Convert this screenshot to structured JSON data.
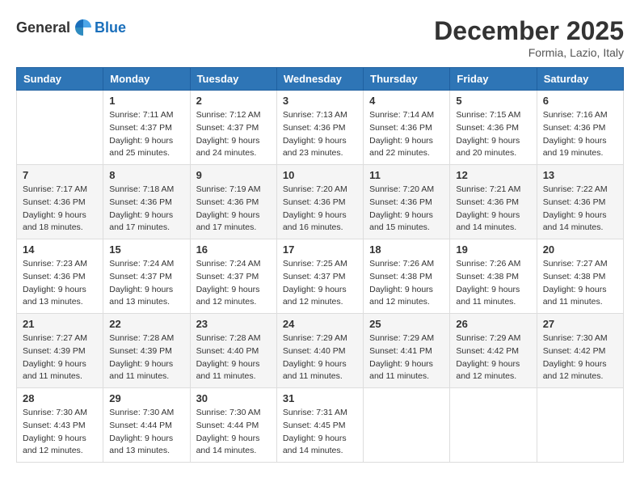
{
  "header": {
    "logo_general": "General",
    "logo_blue": "Blue",
    "month_title": "December 2025",
    "location": "Formia, Lazio, Italy"
  },
  "days_of_week": [
    "Sunday",
    "Monday",
    "Tuesday",
    "Wednesday",
    "Thursday",
    "Friday",
    "Saturday"
  ],
  "weeks": [
    [
      {
        "day": "",
        "info": ""
      },
      {
        "day": "1",
        "info": "Sunrise: 7:11 AM\nSunset: 4:37 PM\nDaylight: 9 hours\nand 25 minutes."
      },
      {
        "day": "2",
        "info": "Sunrise: 7:12 AM\nSunset: 4:37 PM\nDaylight: 9 hours\nand 24 minutes."
      },
      {
        "day": "3",
        "info": "Sunrise: 7:13 AM\nSunset: 4:36 PM\nDaylight: 9 hours\nand 23 minutes."
      },
      {
        "day": "4",
        "info": "Sunrise: 7:14 AM\nSunset: 4:36 PM\nDaylight: 9 hours\nand 22 minutes."
      },
      {
        "day": "5",
        "info": "Sunrise: 7:15 AM\nSunset: 4:36 PM\nDaylight: 9 hours\nand 20 minutes."
      },
      {
        "day": "6",
        "info": "Sunrise: 7:16 AM\nSunset: 4:36 PM\nDaylight: 9 hours\nand 19 minutes."
      }
    ],
    [
      {
        "day": "7",
        "info": "Sunrise: 7:17 AM\nSunset: 4:36 PM\nDaylight: 9 hours\nand 18 minutes."
      },
      {
        "day": "8",
        "info": "Sunrise: 7:18 AM\nSunset: 4:36 PM\nDaylight: 9 hours\nand 17 minutes."
      },
      {
        "day": "9",
        "info": "Sunrise: 7:19 AM\nSunset: 4:36 PM\nDaylight: 9 hours\nand 17 minutes."
      },
      {
        "day": "10",
        "info": "Sunrise: 7:20 AM\nSunset: 4:36 PM\nDaylight: 9 hours\nand 16 minutes."
      },
      {
        "day": "11",
        "info": "Sunrise: 7:20 AM\nSunset: 4:36 PM\nDaylight: 9 hours\nand 15 minutes."
      },
      {
        "day": "12",
        "info": "Sunrise: 7:21 AM\nSunset: 4:36 PM\nDaylight: 9 hours\nand 14 minutes."
      },
      {
        "day": "13",
        "info": "Sunrise: 7:22 AM\nSunset: 4:36 PM\nDaylight: 9 hours\nand 14 minutes."
      }
    ],
    [
      {
        "day": "14",
        "info": "Sunrise: 7:23 AM\nSunset: 4:36 PM\nDaylight: 9 hours\nand 13 minutes."
      },
      {
        "day": "15",
        "info": "Sunrise: 7:24 AM\nSunset: 4:37 PM\nDaylight: 9 hours\nand 13 minutes."
      },
      {
        "day": "16",
        "info": "Sunrise: 7:24 AM\nSunset: 4:37 PM\nDaylight: 9 hours\nand 12 minutes."
      },
      {
        "day": "17",
        "info": "Sunrise: 7:25 AM\nSunset: 4:37 PM\nDaylight: 9 hours\nand 12 minutes."
      },
      {
        "day": "18",
        "info": "Sunrise: 7:26 AM\nSunset: 4:38 PM\nDaylight: 9 hours\nand 12 minutes."
      },
      {
        "day": "19",
        "info": "Sunrise: 7:26 AM\nSunset: 4:38 PM\nDaylight: 9 hours\nand 11 minutes."
      },
      {
        "day": "20",
        "info": "Sunrise: 7:27 AM\nSunset: 4:38 PM\nDaylight: 9 hours\nand 11 minutes."
      }
    ],
    [
      {
        "day": "21",
        "info": "Sunrise: 7:27 AM\nSunset: 4:39 PM\nDaylight: 9 hours\nand 11 minutes."
      },
      {
        "day": "22",
        "info": "Sunrise: 7:28 AM\nSunset: 4:39 PM\nDaylight: 9 hours\nand 11 minutes."
      },
      {
        "day": "23",
        "info": "Sunrise: 7:28 AM\nSunset: 4:40 PM\nDaylight: 9 hours\nand 11 minutes."
      },
      {
        "day": "24",
        "info": "Sunrise: 7:29 AM\nSunset: 4:40 PM\nDaylight: 9 hours\nand 11 minutes."
      },
      {
        "day": "25",
        "info": "Sunrise: 7:29 AM\nSunset: 4:41 PM\nDaylight: 9 hours\nand 11 minutes."
      },
      {
        "day": "26",
        "info": "Sunrise: 7:29 AM\nSunset: 4:42 PM\nDaylight: 9 hours\nand 12 minutes."
      },
      {
        "day": "27",
        "info": "Sunrise: 7:30 AM\nSunset: 4:42 PM\nDaylight: 9 hours\nand 12 minutes."
      }
    ],
    [
      {
        "day": "28",
        "info": "Sunrise: 7:30 AM\nSunset: 4:43 PM\nDaylight: 9 hours\nand 12 minutes."
      },
      {
        "day": "29",
        "info": "Sunrise: 7:30 AM\nSunset: 4:44 PM\nDaylight: 9 hours\nand 13 minutes."
      },
      {
        "day": "30",
        "info": "Sunrise: 7:30 AM\nSunset: 4:44 PM\nDaylight: 9 hours\nand 14 minutes."
      },
      {
        "day": "31",
        "info": "Sunrise: 7:31 AM\nSunset: 4:45 PM\nDaylight: 9 hours\nand 14 minutes."
      },
      {
        "day": "",
        "info": ""
      },
      {
        "day": "",
        "info": ""
      },
      {
        "day": "",
        "info": ""
      }
    ]
  ]
}
